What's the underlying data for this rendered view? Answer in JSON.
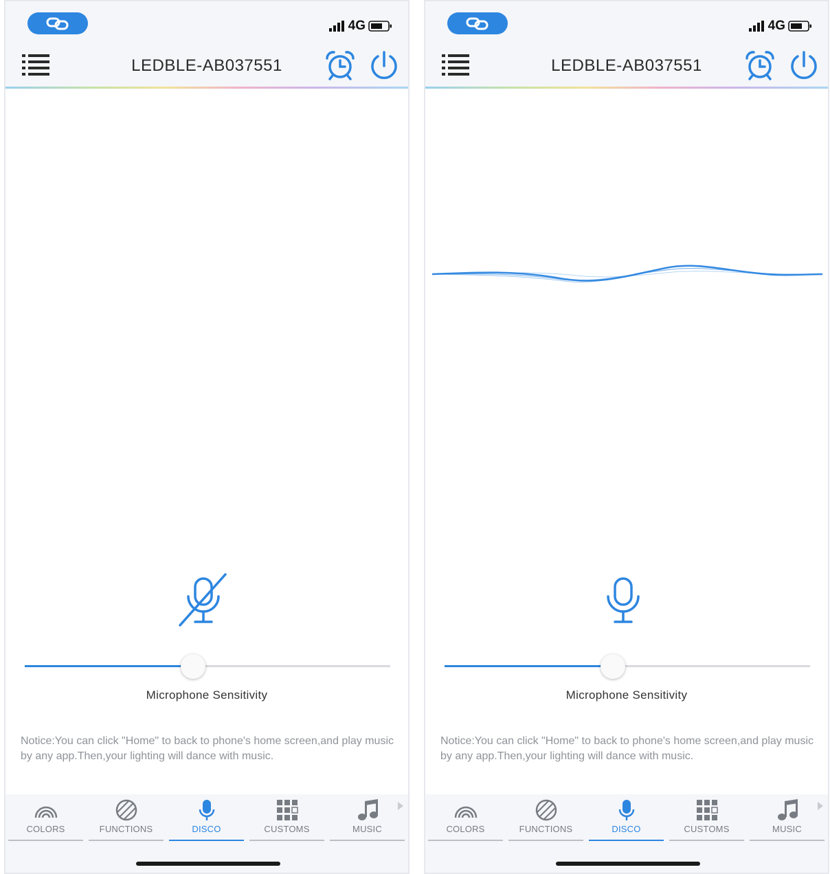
{
  "colors": {
    "accent": "#2d86e0",
    "text": "#2a2a2a",
    "muted": "#8f9399"
  },
  "screens": [
    {
      "status": {
        "network": "4G"
      },
      "header": {
        "title": "LEDBLE-AB037551"
      },
      "microphone": {
        "state": "muted",
        "icon": "microphone-muted-icon"
      },
      "waveform_visible": false,
      "slider": {
        "label": "Microphone Sensitivity",
        "value_fraction": 0.46
      },
      "notice": "Notice:You can click \"Home\" to back to phone's home screen,and play music by any app.Then,your lighting will dance with music.",
      "tabs": [
        {
          "label": "COLORS",
          "icon": "rainbow-icon",
          "active": false
        },
        {
          "label": "FUNCTIONS",
          "icon": "striped-circle-icon",
          "active": false
        },
        {
          "label": "DISCO",
          "icon": "microphone-icon",
          "active": true
        },
        {
          "label": "CUSTOMS",
          "icon": "grid-icon",
          "active": false
        },
        {
          "label": "MUSIC",
          "icon": "music-note-icon",
          "active": false
        }
      ]
    },
    {
      "status": {
        "network": "4G"
      },
      "header": {
        "title": "LEDBLE-AB037551"
      },
      "microphone": {
        "state": "active",
        "icon": "microphone-icon"
      },
      "waveform_visible": true,
      "slider": {
        "label": "Microphone Sensitivity",
        "value_fraction": 0.46
      },
      "notice": "Notice:You can click \"Home\" to back to phone's home screen,and play music by any app.Then,your lighting will dance with music.",
      "tabs": [
        {
          "label": "COLORS",
          "icon": "rainbow-icon",
          "active": false
        },
        {
          "label": "FUNCTIONS",
          "icon": "striped-circle-icon",
          "active": false
        },
        {
          "label": "DISCO",
          "icon": "microphone-icon",
          "active": true
        },
        {
          "label": "CUSTOMS",
          "icon": "grid-icon",
          "active": false
        },
        {
          "label": "MUSIC",
          "icon": "music-note-icon",
          "active": false
        }
      ]
    }
  ]
}
